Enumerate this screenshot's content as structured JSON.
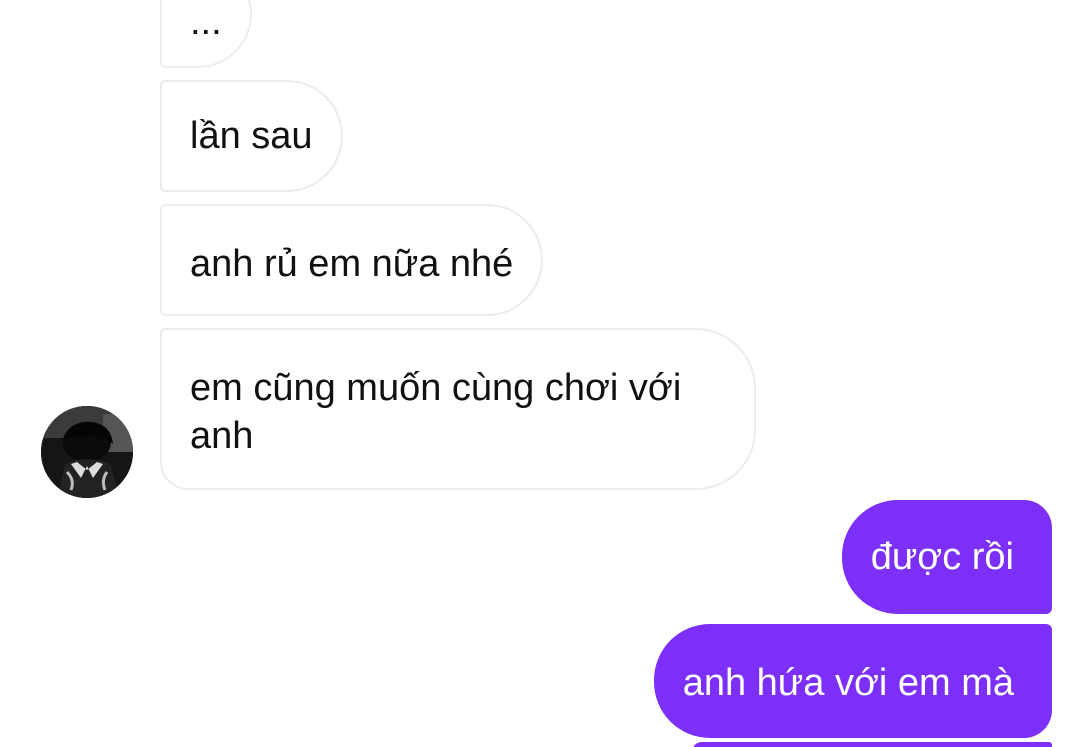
{
  "conversation": {
    "incoming_messages": [
      {
        "text": "..."
      },
      {
        "text": "lần sau"
      },
      {
        "text": "anh rủ em nữa nhé"
      },
      {
        "text": "em cũng muốn cùng chơi với anh"
      }
    ],
    "outgoing_messages": [
      {
        "text": "được rồi"
      },
      {
        "text": "anh hứa với em mà"
      }
    ],
    "sender_avatar": {
      "icon": "profile-photo-avatar"
    }
  },
  "colors": {
    "outgoing_bubble": "#7b2ff7",
    "incoming_bubble": "#ffffff",
    "incoming_border": "#ececec",
    "incoming_text": "#111111",
    "outgoing_text": "#ffffff"
  }
}
